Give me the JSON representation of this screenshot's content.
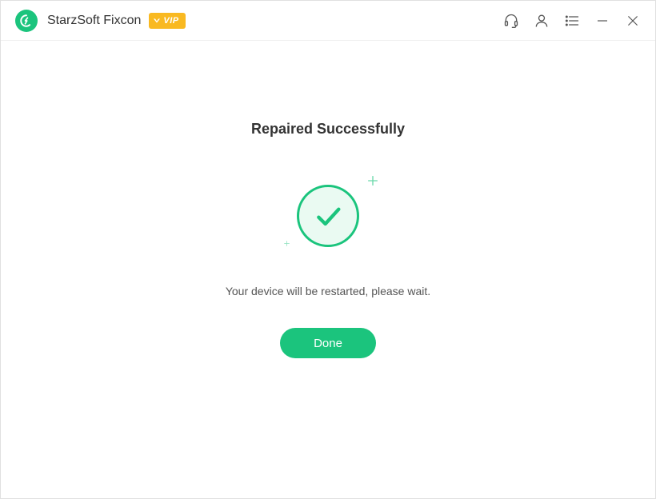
{
  "titlebar": {
    "app_title": "StarzSoft Fixcon",
    "vip_label": "VIP"
  },
  "content": {
    "status_title": "Repaired Successfully",
    "status_message": "Your device will be restarted, please wait.",
    "done_label": "Done"
  },
  "colors": {
    "accent": "#1bc47d",
    "vip": "#f9b921"
  }
}
